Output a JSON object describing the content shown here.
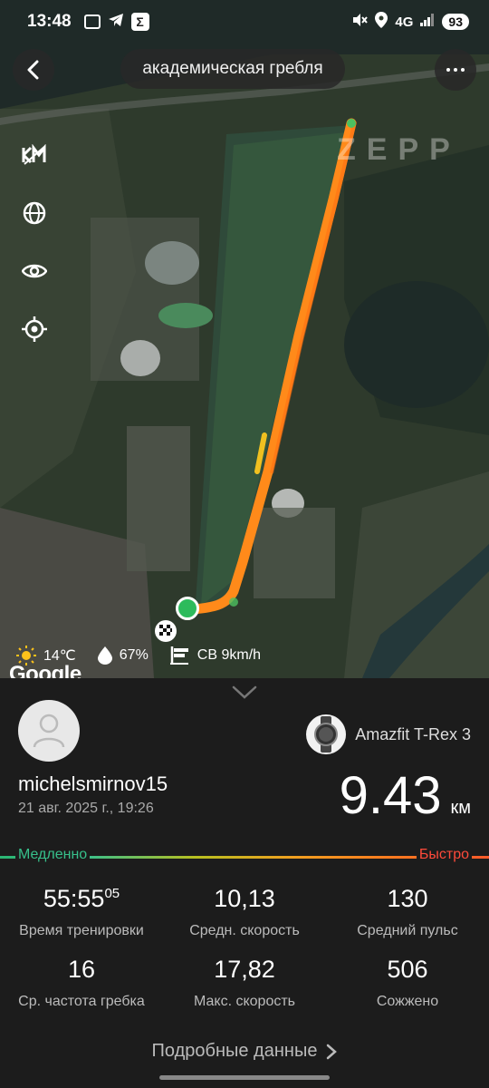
{
  "status": {
    "time": "13:48",
    "network": "4G",
    "battery": "93"
  },
  "header": {
    "title": "академическая гребля"
  },
  "map": {
    "brand": "ZEPP",
    "google": "Google",
    "side_icons": [
      "3d-toggle-icon",
      "globe-icon",
      "eye-icon",
      "locate-icon"
    ],
    "weather": {
      "temperature": "14℃",
      "humidity": "67%",
      "wind": "СВ 9km/h"
    }
  },
  "workout": {
    "username": "michelsmirnov15",
    "date": "21 авг. 2025 г., 19:26",
    "device": "Amazfit T-Rex 3",
    "distance": "9.43",
    "distance_unit": "км",
    "speed_legend": {
      "slow": "Медленно",
      "fast": "Быстро"
    },
    "stats": [
      {
        "value": "55:55",
        "sup": "05",
        "label": "Время тренировки"
      },
      {
        "value": "10,13",
        "sup": "",
        "label": "Средн. скорость"
      },
      {
        "value": "130",
        "sup": "",
        "label": "Средний пульс"
      },
      {
        "value": "16",
        "sup": "",
        "label": "Ср. частота гребка"
      },
      {
        "value": "17,82",
        "sup": "",
        "label": "Макс. скорость"
      },
      {
        "value": "506",
        "sup": "",
        "label": "Сожжено"
      }
    ],
    "details_link": "Подробные данные"
  },
  "colors": {
    "route_orange": "#ff8a1a",
    "slow_green": "#37c08b",
    "fast_red": "#ff4a3a"
  }
}
